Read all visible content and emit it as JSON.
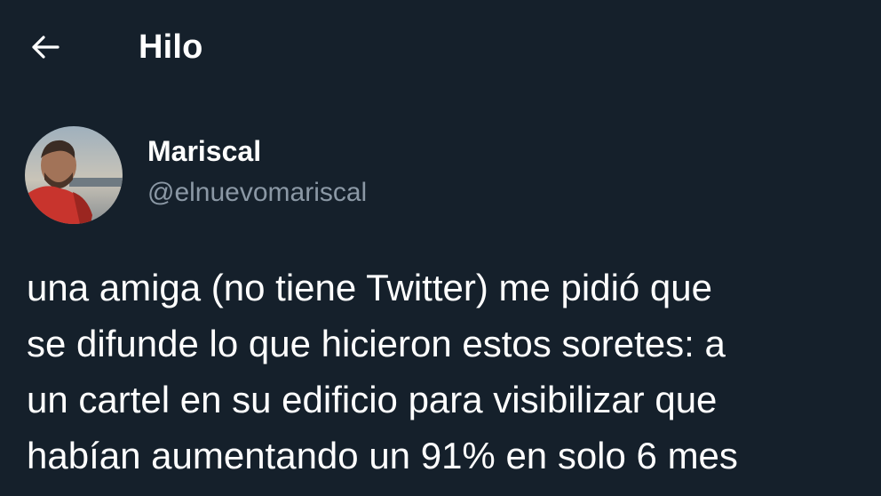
{
  "header": {
    "back_icon": "arrow-left-icon",
    "title": "Hilo"
  },
  "tweet": {
    "author": {
      "name": "Mariscal",
      "handle": "@elnuevomariscal",
      "avatar_icon": "user-avatar"
    },
    "text_lines": [
      "una amiga (no tiene Twitter) me pidió que",
      "se difunde lo que hicieron estos soretes: a",
      "un cartel en su edificio para visibilizar que",
      "habían aumentando un 91% en solo 6 mes"
    ]
  },
  "colors": {
    "background": "#15202b",
    "text_primary": "#ffffff",
    "text_secondary": "#8b98a5"
  }
}
